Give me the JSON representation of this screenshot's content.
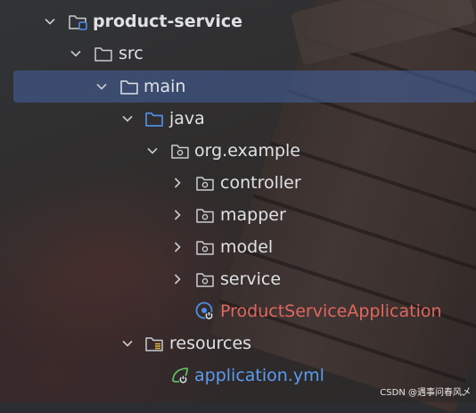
{
  "project_tree": {
    "items": [
      {
        "label": "product-service"
      },
      {
        "label": "src"
      },
      {
        "label": "main"
      },
      {
        "label": "java"
      },
      {
        "label": "org.example"
      },
      {
        "label": "controller"
      },
      {
        "label": "mapper"
      },
      {
        "label": "model"
      },
      {
        "label": "service"
      },
      {
        "label": "ProductServiceApplication"
      },
      {
        "label": "resources"
      },
      {
        "label": "application.yml"
      }
    ]
  },
  "icons": {
    "module": "module-folder-icon",
    "folder": "folder-icon",
    "source_root": "source-root-folder-icon",
    "package": "package-icon",
    "spring_boot_app": "spring-boot-application-icon",
    "resources_root": "resources-root-folder-icon",
    "yaml_file": "spring-yaml-file-icon"
  },
  "colors": {
    "selection": "#425e96",
    "text": "#dfe1e5",
    "error_text": "#e0675f",
    "yaml_text": "#5a9cf0",
    "source_root_icon": "#4f8fe6",
    "spring_green": "#5fb85f"
  },
  "watermark": "CSDN @遇事问春风乄"
}
